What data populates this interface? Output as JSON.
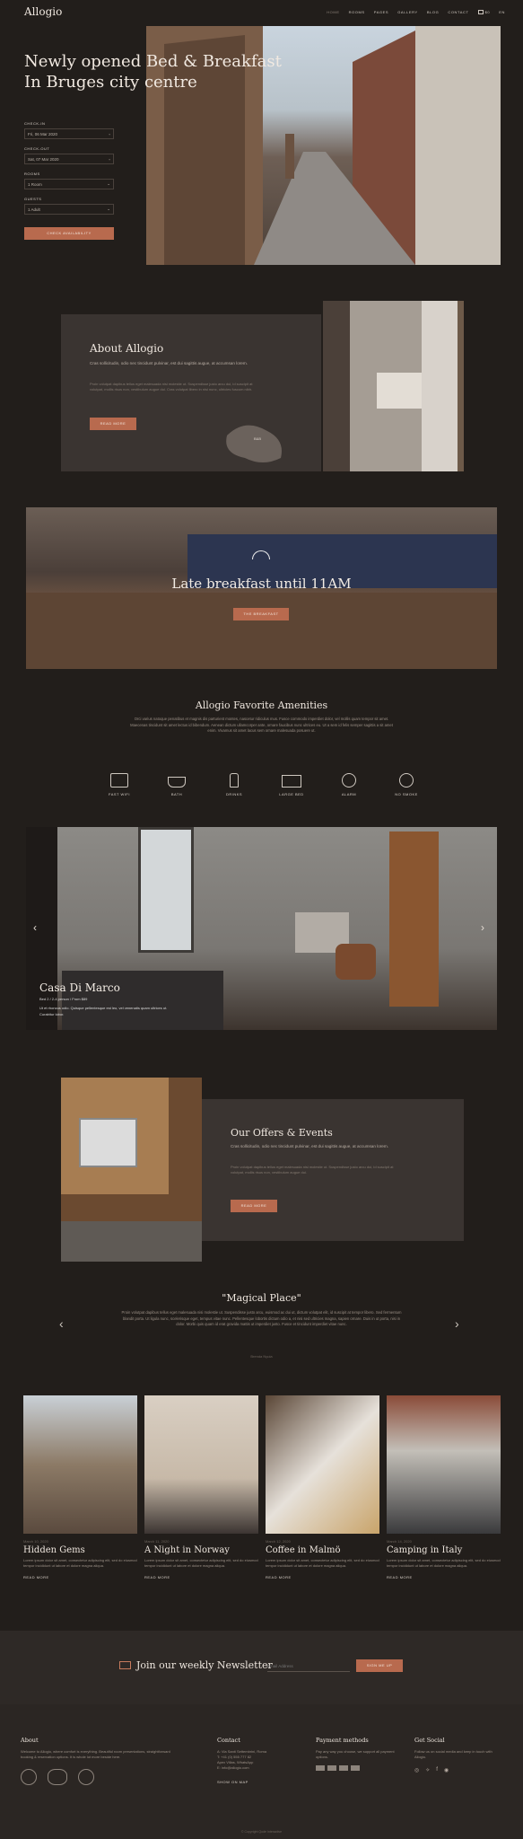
{
  "colors": {
    "bg": "#221e1b",
    "panel": "#3a3431",
    "accent": "#b86a4e"
  },
  "header": {
    "logo": "Allogio",
    "nav": [
      "HOME",
      "ROOMS",
      "PAGES",
      "GALLERY",
      "BLOG",
      "CONTACT"
    ],
    "cart": "$0",
    "lang": "EN"
  },
  "hero": {
    "title1": "Newly opened Bed & Breakfast",
    "title2": "In Bruges city centre",
    "checkin_label": "CHECK-IN",
    "checkin_value": "Fri, 06 Mar 2020",
    "checkout_label": "CHECK-OUT",
    "checkout_value": "Sat, 07 Mar 2020",
    "rooms_label": "ROOMS",
    "rooms_value": "1 Room",
    "guests_label": "GUESTS",
    "guests_value": "1 Adult",
    "button": "CHECK AVAILABILITY"
  },
  "about": {
    "title": "About Allogio",
    "lead": "Cras sollicitudin, odio nec tincidunt pulvinar, est dui sagittis augue, at accumsan lorem.",
    "body": "Proin volutpat dapibus tellus eget malesuada nisi molestie ut. Suspendisse justo arcu dui, id suscipit at volutpat, mollis risus non, vestibulum augue dui. Cras volutpat libero in nisi nunc, ultricies fuscum nibh.",
    "button": "READ MORE",
    "map_label": "B&B"
  },
  "breakfast": {
    "title": "Late breakfast until 11AM",
    "button": "THE BREAKFAST"
  },
  "amenities": {
    "title": "Allogio Favorite Amenities",
    "text": "Orci varius natoque penatibus et magnis dis parturient montes, nascetur ridiculus mus. Fusce commodo imperdiet dolor, vel mollis quam tempor sit amet. Maecenas tincidunt sit amet lectus id bibendum. Aenean dictum ullamcorper ante, ornare faucibus nunc ultrices eu. Ut a sem id felis semper sagittis a sit amet enim. Vivamus sit amet lacus sem ornare malesuada posuere ut.",
    "items": [
      {
        "label": "FAST WIFI",
        "icon": "wifi-icon"
      },
      {
        "label": "BATH",
        "icon": "bath-icon"
      },
      {
        "label": "DRINKS",
        "icon": "drinks-icon"
      },
      {
        "label": "LARGE BED",
        "icon": "bed-icon"
      },
      {
        "label": "ALARM",
        "icon": "alarm-icon"
      },
      {
        "label": "NO SMOKE",
        "icon": "no-smoke-icon"
      }
    ]
  },
  "room": {
    "title": "Casa Di Marco",
    "subtitle": "Bed 2 / 2-4 person / From $89",
    "desc1": "Ut et rhoncus odio. Quisque pellentesque est leo, vel venenatis quam ultrices ut.",
    "desc2": "Curabitur lobor."
  },
  "offers": {
    "title": "Our Offers & Events",
    "lead": "Cras sollicitudin, odio nec tincidunt pulvinar, est dui sagittis augue, at accumsan lorem.",
    "body": "Proin volutpat dapibus tellus eget malesuada nisi molestie ut. Suspendisse justo arcu dui, id suscipit at volutpat, mollis risus non, vestibulum augue dui.",
    "button": "READ MORE"
  },
  "testimonial": {
    "title": "\"Magical Place\"",
    "text": "Proin volutpat dapibus tellus eget malesuada nisi molestie ut. Suspendisse justo arcu, euismod ac dui ut, dictum volutpat elit, id suscipit at tempor libero. Sed fermentum blandit porta. Ut ligula nunc, scelerisque eget, tempus vitae nunc. Pellentesque lobortis dictum odio a, et nisi sed ultricies magna, sapien ornare. Duis in ut porta, nisi in dolor. Morbi quis quam id erat gravida mattis ut imperdiet justo. Fusce et tincidunt imperdiet vitae nunc.",
    "author": "Brenda Nyuia"
  },
  "blog": [
    {
      "date": "March 10, 2020",
      "title": "Hidden Gems",
      "excerpt": "Lorem ipsum dolor sit amet, consectetur adipiscing elit, sed do eiusmod tempor incididunt ut labore et dolore magna aliqua.",
      "more": "READ MORE"
    },
    {
      "date": "March 11, 2020",
      "title": "A Night in Norway",
      "excerpt": "Lorem ipsum dolor sit amet, consectetur adipiscing elit, sed do eiusmod tempor incididunt ut labore et dolore magna aliqua.",
      "more": "READ MORE"
    },
    {
      "date": "March 12, 2020",
      "title": "Coffee in Malmö",
      "excerpt": "Lorem ipsum dolor sit amet, consectetur adipiscing elit, sed do eiusmod tempor incididunt ut labore et dolore magna aliqua.",
      "more": "READ MORE"
    },
    {
      "date": "March 14, 2020",
      "title": "Camping in Italy",
      "excerpt": "Lorem ipsum dolor sit amet, consectetur adipiscing elit, sed do eiusmod tempor incididunt ut labore et dolore magna aliqua.",
      "more": "READ MORE"
    }
  ],
  "newsletter": {
    "title": "Join our weekly Newsletter",
    "placeholder": "Email Address",
    "button": "SIGN ME UP"
  },
  "footer": {
    "about_title": "About",
    "about_text": "Welcome to Allogio, where comfort is everything. Beautiful room presentations, straightforward booking & reservation options. It is whole lot more beside here.",
    "badges": [
      "badge-1",
      "badge-2",
      "badge-3"
    ],
    "contact_title": "Contact",
    "contact_lines": [
      "A: Via Santi Settembrini, Roma",
      "T: +41 (0) 555 777 82",
      "Apex Villas, WhatsApp",
      "E: info@allogio.com"
    ],
    "map_link": "SHOW ON MAP",
    "payment_title": "Payment methods",
    "payment_text": "Pay any way you choose, we support all payment options.",
    "social_title": "Get Social",
    "social_text": "Follow us on social media and keep in touch with Allogio.",
    "copyright": "© Copyright Qode Interactive"
  }
}
